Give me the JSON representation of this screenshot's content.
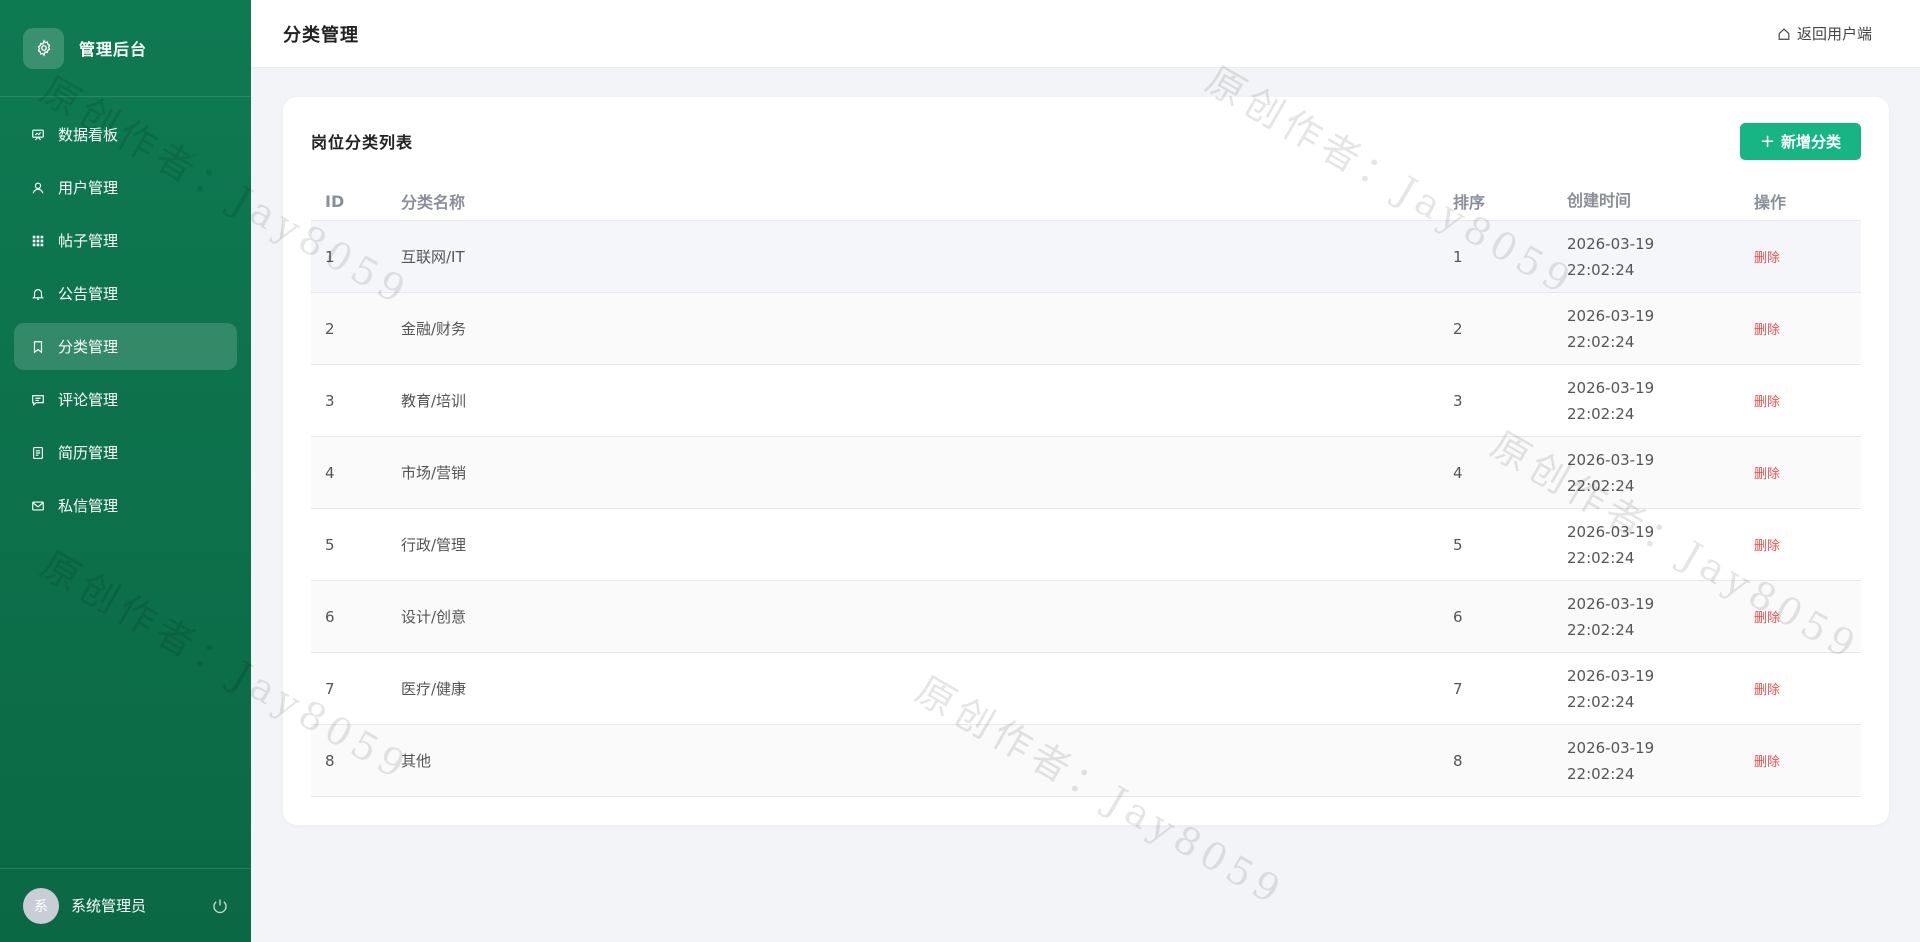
{
  "app": {
    "brand_title": "管理后台"
  },
  "sidebar": {
    "items": [
      {
        "label": "数据看板",
        "icon": "chart-board-icon"
      },
      {
        "label": "用户管理",
        "icon": "user-icon"
      },
      {
        "label": "帖子管理",
        "icon": "grid-icon"
      },
      {
        "label": "公告管理",
        "icon": "bell-icon"
      },
      {
        "label": "分类管理",
        "icon": "bookmark-icon",
        "active": true
      },
      {
        "label": "评论管理",
        "icon": "comment-icon"
      },
      {
        "label": "简历管理",
        "icon": "document-icon"
      },
      {
        "label": "私信管理",
        "icon": "mail-icon"
      }
    ],
    "user": {
      "avatar_text": "系",
      "name": "系统管理员"
    }
  },
  "header": {
    "title": "分类管理",
    "back_label": "返回用户端"
  },
  "card": {
    "title": "岗位分类列表",
    "add_label": "新增分类"
  },
  "table": {
    "columns": [
      "ID",
      "分类名称",
      "排序",
      "创建时间",
      "操作"
    ],
    "rows": [
      {
        "id": "1",
        "name": "互联网/IT",
        "sort": "1",
        "date": "2026-03-19",
        "time": "22:02:24",
        "action": "删除"
      },
      {
        "id": "2",
        "name": "金融/财务",
        "sort": "2",
        "date": "2026-03-19",
        "time": "22:02:24",
        "action": "删除"
      },
      {
        "id": "3",
        "name": "教育/培训",
        "sort": "3",
        "date": "2026-03-19",
        "time": "22:02:24",
        "action": "删除"
      },
      {
        "id": "4",
        "name": "市场/营销",
        "sort": "4",
        "date": "2026-03-19",
        "time": "22:02:24",
        "action": "删除"
      },
      {
        "id": "5",
        "name": "行政/管理",
        "sort": "5",
        "date": "2026-03-19",
        "time": "22:02:24",
        "action": "删除"
      },
      {
        "id": "6",
        "name": "设计/创意",
        "sort": "6",
        "date": "2026-03-19",
        "time": "22:02:24",
        "action": "删除"
      },
      {
        "id": "7",
        "name": "医疗/健康",
        "sort": "7",
        "date": "2026-03-19",
        "time": "22:02:24",
        "action": "删除"
      },
      {
        "id": "8",
        "name": "其他",
        "sort": "8",
        "date": "2026-03-19",
        "time": "22:02:24",
        "action": "删除"
      }
    ]
  },
  "watermark": {
    "text": "原创作者：Jay8059"
  },
  "colors": {
    "sidebar": "#0e7a52",
    "accent": "#17b584",
    "danger": "#f05050",
    "background": "#f2f4f7"
  }
}
